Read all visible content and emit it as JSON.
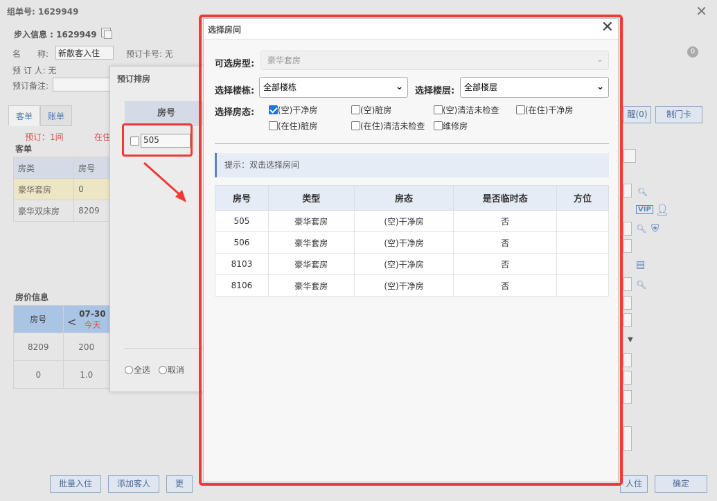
{
  "background": {
    "title": "组单号: 1629949",
    "checkin_title": "步入信息 : 1629949",
    "name_label": "名　　称:",
    "name_value": "新散客入住",
    "card_label": "预订卡号: 无",
    "booker_label": "预 订 人: 无",
    "booking_note_label": "预订备注:",
    "tabs": [
      {
        "label": "客单"
      },
      {
        "label": "账单"
      }
    ],
    "status_booked": "预订：1间",
    "status_in": "在住",
    "guest_section": "客单",
    "guest_table": {
      "headers": [
        "房类",
        "房号"
      ],
      "rows": [
        {
          "type": "豪华套房",
          "room": "0"
        },
        {
          "type": "豪华双床房",
          "room": "8209"
        }
      ]
    },
    "price_section": "房价信息",
    "price_table": {
      "room_header": "房号",
      "prev": "<",
      "date": "07-30",
      "today": "今天",
      "rows": [
        {
          "room": "8209",
          "price": "200"
        },
        {
          "room": "0",
          "price": "1.0"
        }
      ]
    },
    "right_buttons": {
      "remind": "醒(0)",
      "make_card": "制门卡"
    },
    "vip_label": "VIP",
    "bottom_buttons": [
      {
        "label": "批量入住"
      },
      {
        "label": "添加客人"
      },
      {
        "label": "更"
      }
    ],
    "confirm_button": "确定",
    "checkin_button": "人住"
  },
  "mid_dialog": {
    "title": "预订排房",
    "room_header": "房号",
    "room_value": "505",
    "select_all": "全选",
    "cancel": "取消"
  },
  "modal": {
    "title": "选择房间",
    "room_type_label": "可选房型:",
    "room_type_value": "豪华套房",
    "building_label": "选择楼栋:",
    "building_value": "全部楼栋",
    "floor_label": "选择楼层:",
    "floor_value": "全部楼层",
    "status_label": "选择房态:",
    "statuses": [
      {
        "label": "(空)干净房",
        "checked": true
      },
      {
        "label": "(空)脏房",
        "checked": false
      },
      {
        "label": "(空)清洁未检查",
        "checked": false
      },
      {
        "label": "(在住)干净房",
        "checked": false
      },
      {
        "label": "(在住)脏房",
        "checked": false
      },
      {
        "label": "(在住)清洁未检查",
        "checked": false
      },
      {
        "label": "维修房",
        "checked": false
      }
    ],
    "tip": "提示：双击选择房间",
    "table": {
      "headers": [
        "房号",
        "类型",
        "房态",
        "是否临时态",
        "方位"
      ],
      "rows": [
        {
          "room": "505",
          "type": "豪华套房",
          "status": "(空)干净房",
          "temp": "否",
          "direction": ""
        },
        {
          "room": "506",
          "type": "豪华套房",
          "status": "(空)干净房",
          "temp": "否",
          "direction": ""
        },
        {
          "room": "8103",
          "type": "豪华套房",
          "status": "(空)干净房",
          "temp": "否",
          "direction": ""
        },
        {
          "room": "8106",
          "type": "豪华套房",
          "status": "(空)干净房",
          "temp": "否",
          "direction": ""
        }
      ]
    }
  },
  "colors": {
    "annotation_red": "#f03a35",
    "accent_blue": "#1a73e8",
    "tip_bg": "#e6ecf6"
  }
}
